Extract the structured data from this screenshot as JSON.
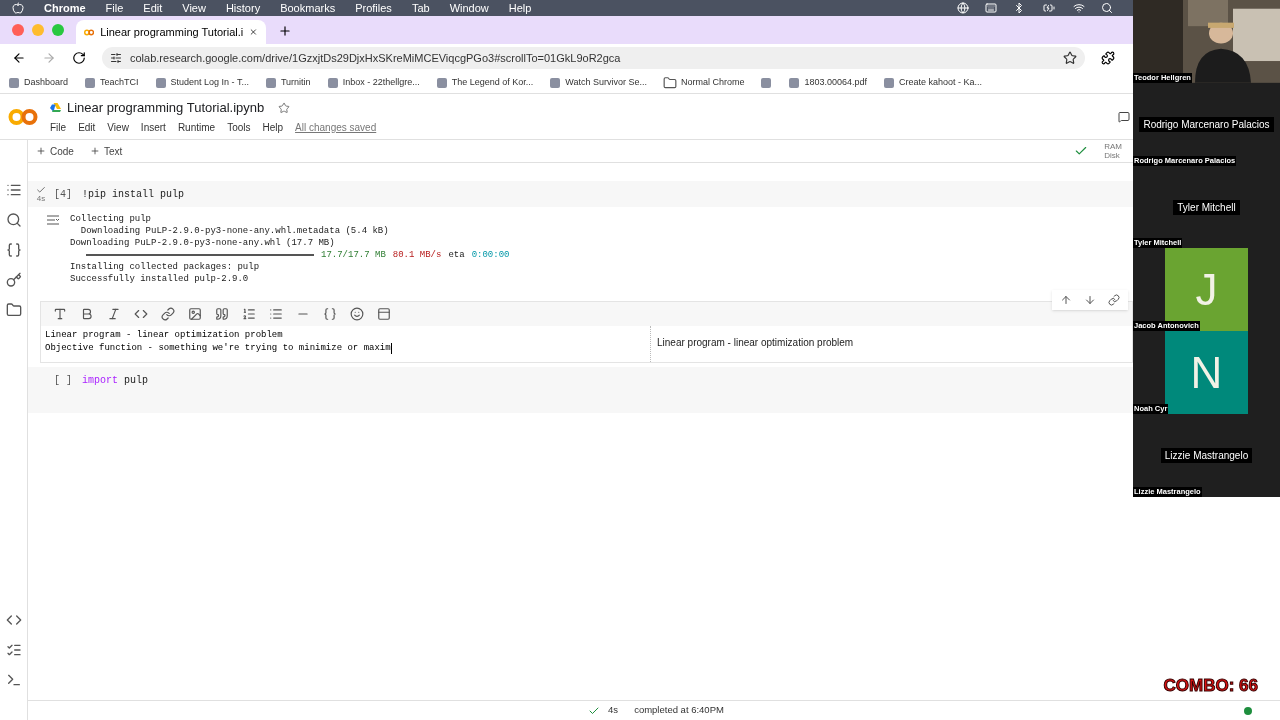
{
  "menubar": {
    "app": "Chrome",
    "items": [
      "File",
      "Edit",
      "View",
      "History",
      "Bookmarks",
      "Profiles",
      "Tab",
      "Window",
      "Help"
    ]
  },
  "tabs": [
    {
      "title": "Linear programming Tutorial.i",
      "selected": true
    }
  ],
  "address": "colab.research.google.com/drive/1GzxjtDs29DjxHxSKreMiMCEViqcgPGo3#scrollTo=01GkL9oR2gca",
  "bookmarks": [
    {
      "label": "Dashboard",
      "kind": "site"
    },
    {
      "label": "TeachTCI",
      "kind": "site"
    },
    {
      "label": "Student Log In - T...",
      "kind": "site"
    },
    {
      "label": "Turnitin",
      "kind": "site"
    },
    {
      "label": "Inbox - 22thellgre...",
      "kind": "site"
    },
    {
      "label": "The Legend of Kor...",
      "kind": "site"
    },
    {
      "label": "Watch Survivor Se...",
      "kind": "site"
    },
    {
      "label": "Normal Chrome",
      "kind": "folder"
    },
    {
      "kind": "site"
    },
    {
      "label": "1803.00064.pdf",
      "kind": "site"
    },
    {
      "label": "Create kahoot - Ka...",
      "kind": "site"
    }
  ],
  "notebook": {
    "title": "Linear programming Tutorial.ipynb",
    "starred": false,
    "menus": [
      "File",
      "Edit",
      "View",
      "Insert",
      "Runtime",
      "Tools",
      "Help"
    ],
    "save_status": "All changes saved",
    "add_buttons": [
      "Code",
      "Text"
    ],
    "runtime": [
      "RAM",
      "Disk"
    ],
    "connected": true
  },
  "cells": [
    {
      "kind": "code",
      "prompt": "[4]",
      "executed": true,
      "run_time": "4s",
      "code": [
        {
          "kind": "plain",
          "text": "!pip install pulp"
        }
      ],
      "output": [
        {
          "kind": "text",
          "segments": [
            {
              "kind": "plain",
              "text": "Collecting pulp"
            }
          ]
        },
        {
          "kind": "text",
          "segments": [
            {
              "kind": "plain",
              "text": "  Downloading PuLP-2.9.0-py3-none-any.whl.metadata (5.4 kB)"
            }
          ]
        },
        {
          "kind": "text",
          "segments": [
            {
              "kind": "plain",
              "text": "Downloading PuLP-2.9.0-py3-none-any.whl (17.7 MB)"
            }
          ]
        },
        {
          "kind": "progress",
          "level": 1,
          "segments": [
            {
              "kind": "size",
              "text": "17.7/17.7 MB"
            },
            {
              "kind": "rate",
              "text": "80.1 MB/s"
            },
            {
              "kind": "plain",
              "text": "eta"
            },
            {
              "kind": "eta",
              "text": "0:00:00"
            }
          ]
        },
        {
          "kind": "text",
          "segments": [
            {
              "kind": "plain",
              "text": "Installing collected packages: pulp"
            }
          ]
        },
        {
          "kind": "text",
          "segments": [
            {
              "kind": "plain",
              "text": "Successfully installed pulp-2.9.0"
            }
          ]
        }
      ]
    },
    {
      "kind": "text_edit",
      "source": [
        "Linear program - linear optimization problem",
        "Objective function - something we're trying to minimize or maxim"
      ],
      "preview": "Linear program - linear optimization problem"
    },
    {
      "kind": "code",
      "prompt": "[ ]",
      "executed": false,
      "code": [
        {
          "kind": "keyword",
          "text": "import"
        },
        {
          "kind": "plain",
          "text": " pulp"
        }
      ]
    }
  ],
  "status_bar": {
    "elapsed": "4s",
    "message": "completed at 6:40PM",
    "connected": true
  },
  "participants": [
    {
      "kind": "video",
      "label": "Teodor Hellgren"
    },
    {
      "kind": "blank",
      "display_name": "Rodrigo Marcenaro Palacios",
      "label": "Rodrigo Marcenaro Palacios"
    },
    {
      "kind": "blank",
      "display_name": "Tyler Mitchell",
      "label": "Tyler Mitchell"
    },
    {
      "kind": "avatar",
      "initial": "J",
      "color": "#6aa431",
      "label": "Jacob Antonovich"
    },
    {
      "kind": "avatar",
      "initial": "N",
      "color": "#00897b",
      "label": "Noah Cyr"
    },
    {
      "kind": "blank",
      "display_name": "Lizzie Mastrangelo",
      "label": "Lizzie Mastrangelo"
    }
  ],
  "overlay_counter": "COMBO: 66"
}
